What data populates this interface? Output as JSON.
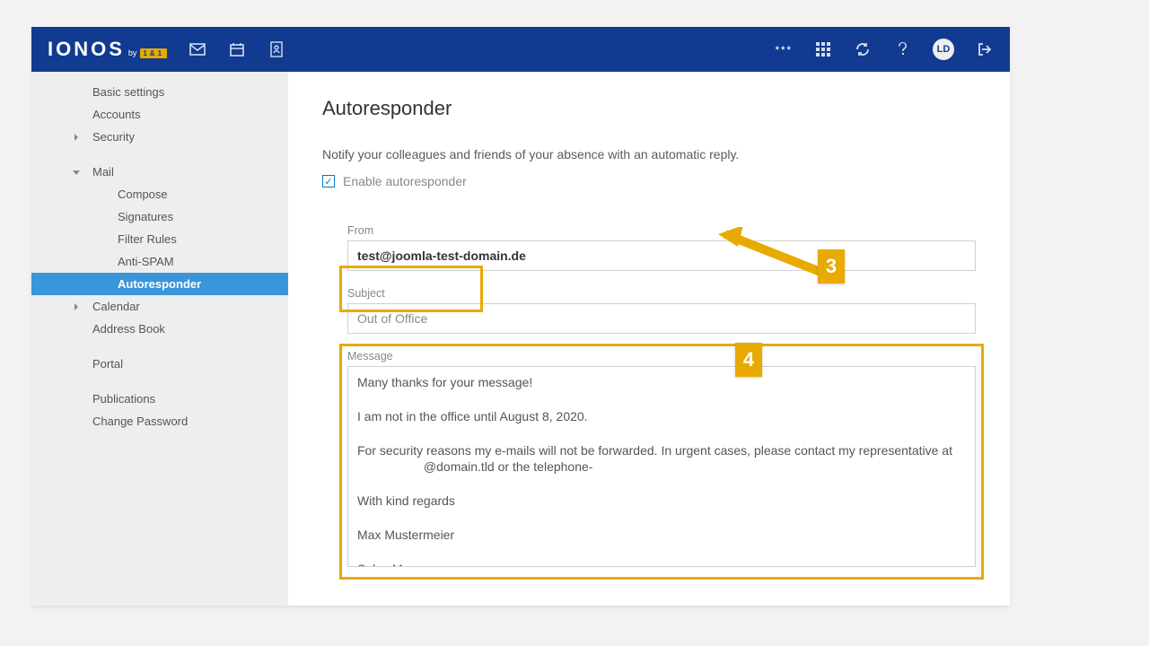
{
  "brand": {
    "name": "IONOS",
    "tail": "by",
    "tag": "1&1"
  },
  "avatar": "LD",
  "sidebar": {
    "items": [
      {
        "label": "Basic settings",
        "lvl": 0
      },
      {
        "label": "Accounts",
        "lvl": 0
      },
      {
        "label": "Security",
        "lvl": 0,
        "expander": true
      },
      {
        "label": "Mail",
        "lvl": 0,
        "expander": true,
        "open": true
      },
      {
        "label": "Compose",
        "lvl": 1
      },
      {
        "label": "Signatures",
        "lvl": 1
      },
      {
        "label": "Filter Rules",
        "lvl": 1
      },
      {
        "label": "Anti-SPAM",
        "lvl": 1
      },
      {
        "label": "Autoresponder",
        "lvl": 1,
        "active": true
      },
      {
        "label": "Calendar",
        "lvl": 0,
        "expander": true
      },
      {
        "label": "Address Book",
        "lvl": 0
      },
      {
        "label": "Portal",
        "lvl": 0
      },
      {
        "label": "Publications",
        "lvl": 0
      },
      {
        "label": "Change Password",
        "lvl": 0
      }
    ]
  },
  "page": {
    "title": "Autoresponder",
    "lead": "Notify your colleagues and friends of your absence with an automatic reply.",
    "enable": "Enable autoresponder",
    "from_label": "From",
    "from_value": "test@joomla-test-domain.de",
    "subject_label": "Subject",
    "subject_value": "Out of Office",
    "message_label": "Message",
    "message_value": "Many thanks for your message!\n\nI am not in the office until August 8, 2020.\n\nFor security reasons my e-mails will not be forwarded. In urgent cases, please contact my representative at\n                   @domain.tld or the telephone-\n\nWith kind regards\n\nMax Mustermeier\n\nSales Manager"
  },
  "annotations": {
    "a3": "3",
    "a4": "4"
  }
}
